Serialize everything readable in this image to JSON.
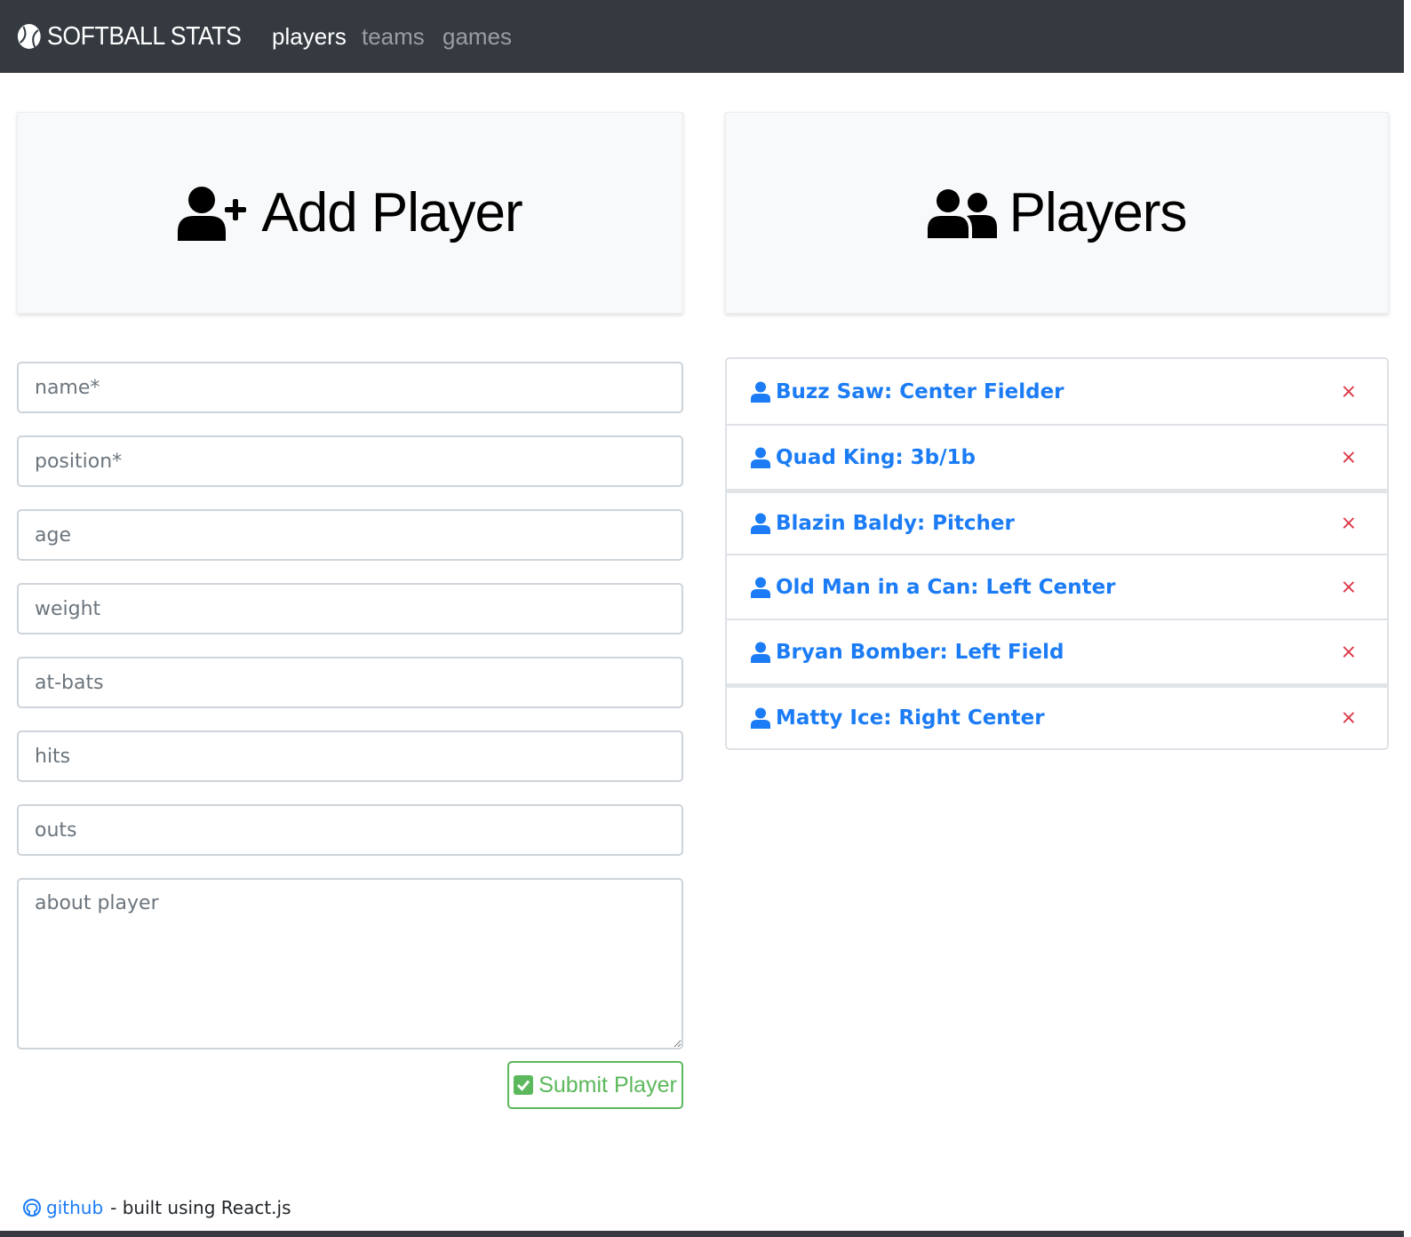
{
  "navbar": {
    "brand": "SOFTBALL STATS",
    "brand_icon": "baseball-icon",
    "links": [
      {
        "label": "players",
        "active": true
      },
      {
        "label": "teams",
        "active": false
      },
      {
        "label": "games",
        "active": false
      }
    ]
  },
  "add_player": {
    "title": "Add Player",
    "icon": "user-plus-icon",
    "fields": {
      "name": "name*",
      "position": "position*",
      "age": "age",
      "weight": "weight",
      "at_bats": "at-bats",
      "hits": "hits",
      "outs": "outs",
      "about": "about player"
    },
    "submit_label": "Submit Player",
    "submit_icon": "check-square-icon"
  },
  "players": {
    "title": "Players",
    "icon": "users-icon",
    "items": [
      {
        "label": "Buzz Saw: Center Fielder"
      },
      {
        "label": "Quad King: 3b/1b"
      },
      {
        "label": "Blazin Baldy: Pitcher"
      },
      {
        "label": "Old Man in a Can: Left Center"
      },
      {
        "label": "Bryan Bomber: Left Field"
      },
      {
        "label": "Matty Ice: Right Center"
      }
    ],
    "delete_glyph": "×"
  },
  "footer": {
    "link_label": "github",
    "link_icon": "github-icon",
    "suffix": "- built using React.js"
  },
  "colors": {
    "navbar_bg": "#343a40",
    "link_blue": "#1b7cf5",
    "delete_red": "#dc3545",
    "success_green": "#5cb85c"
  }
}
